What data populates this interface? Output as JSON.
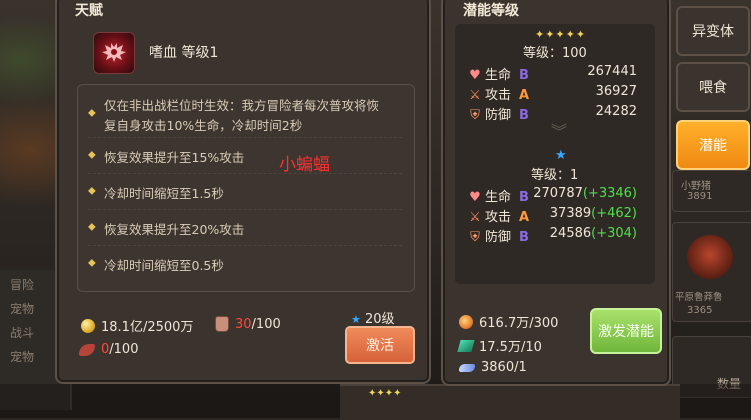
{
  "talent_panel": {
    "title": "天赋",
    "talent_name": "嗜血 等级1",
    "effects": [
      "仅在非出战栏位时生效：我方冒险者每次普攻将恢",
      "复自身攻击10%生命，冷却时间2秒",
      "恢复效果提升至15%攻击",
      "冷却时间缩短至1.5秒",
      "恢复效果提升至20%攻击",
      "冷却时间缩短至0.5秒"
    ],
    "annotation": "小蝙蝠",
    "gold": "18.1亿/2500万",
    "potion_have": "30",
    "potion_need": "/100",
    "wing_have": "0",
    "wing_need": "/100",
    "level_requirement": "20级",
    "activate_label": "激活"
  },
  "potential_panel": {
    "title": "潜能等级",
    "current": {
      "level": "等级：100",
      "stats": [
        {
          "icon": "heart-icon",
          "name": "生命",
          "grade": "B",
          "value": "267441"
        },
        {
          "icon": "sword-icon",
          "name": "攻击",
          "grade": "A",
          "value": "36927"
        },
        {
          "icon": "shield-icon",
          "name": "防御",
          "grade": "B",
          "value": "24282"
        }
      ]
    },
    "next": {
      "level": "等级：1",
      "stats": [
        {
          "icon": "heart-icon",
          "name": "生命",
          "grade": "B",
          "value": "270787",
          "plus": "(+3346)"
        },
        {
          "icon": "sword-icon",
          "name": "攻击",
          "grade": "A",
          "value": "37389",
          "plus": "(+462)"
        },
        {
          "icon": "shield-icon",
          "name": "防御",
          "grade": "B",
          "value": "24586",
          "plus": "(+304)"
        }
      ]
    },
    "costs": [
      "616.7万/300",
      "17.5万/10",
      "3860/1"
    ],
    "awaken_label": "激发潜能"
  },
  "tabs": {
    "mutant": "异变体",
    "feed": "喂食",
    "potential": "潜能"
  },
  "background": {
    "left_texts": [
      "冒险",
      "宠物",
      "战斗",
      "宠物"
    ],
    "side_names": [
      "小野猪",
      "平原鲁莽鲁"
    ],
    "side_numbers": [
      "3891",
      "3365"
    ],
    "bottom_right": "数量"
  },
  "colors": {
    "grade_A": "#ff9a3a",
    "grade_B": "#8a6ae0",
    "bonus": "#4ee04a",
    "annotation": "#ff3030",
    "active_tab": "#f08a12"
  }
}
